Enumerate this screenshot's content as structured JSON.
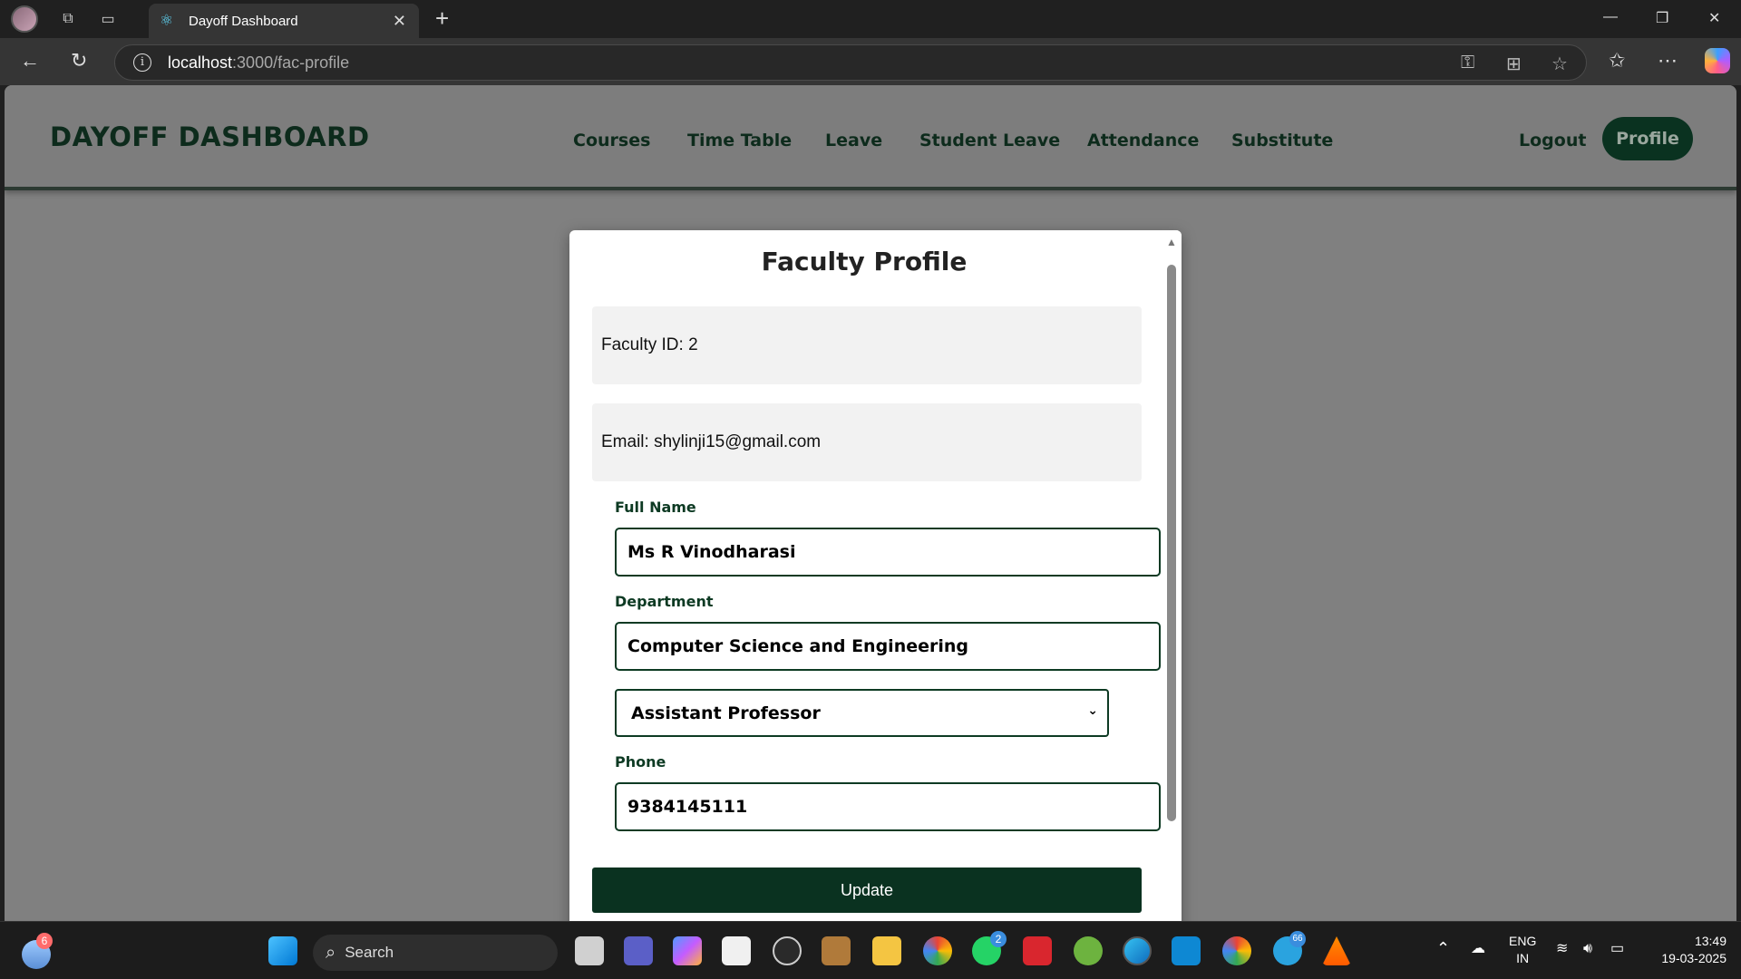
{
  "browser": {
    "tab_title": "Dayoff Dashboard",
    "url_host": "localhost",
    "url_path": ":3000/fac-profile"
  },
  "header": {
    "brand": "DAYOFF DASHBOARD",
    "nav": [
      "Courses",
      "Time Table",
      "Leave",
      "Student Leave",
      "Attendance",
      "Substitute"
    ],
    "logout": "Logout",
    "profile": "Profile"
  },
  "modal": {
    "title": "Faculty Profile",
    "faculty_id": "Faculty ID: 2",
    "email": "Email: shylinji15@gmail.com",
    "full_name_label": "Full Name",
    "full_name_value": "Ms R Vinodharasi",
    "department_label": "Department",
    "department_value": "Computer Science and Engineering",
    "designation_value": "Assistant Professor",
    "phone_label": "Phone",
    "phone_value": "9384145111",
    "update_label": "Update"
  },
  "taskbar": {
    "search_placeholder": "Search",
    "weather_badge": "6",
    "whatsapp_badge": "2",
    "telegram_badge": "66",
    "language": "ENG",
    "region": "IN",
    "time": "13:49",
    "date": "19-03-2025"
  },
  "colors": {
    "accent": "#0a3220",
    "header_bg": "#7d7d7d",
    "overlay": "#808080"
  }
}
